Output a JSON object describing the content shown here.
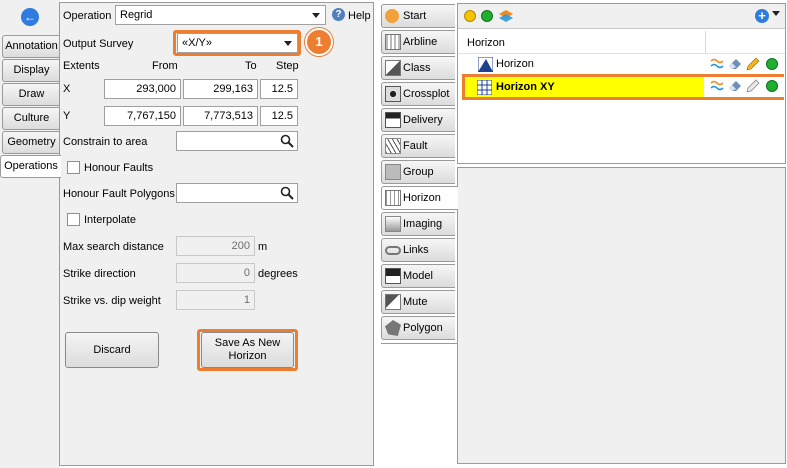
{
  "left_tabs": [
    "Annotation",
    "Display",
    "Draw",
    "Culture",
    "Geometry",
    "Operations"
  ],
  "operation": {
    "label": "Operation",
    "value": "Regrid",
    "help_label": "Help"
  },
  "output_survey": {
    "label": "Output Survey",
    "value": "«X/Y»",
    "callout": "1"
  },
  "extents": {
    "label": "Extents",
    "col_from": "From",
    "col_to": "To",
    "col_step": "Step",
    "x_label": "X",
    "x_from": "293,000",
    "x_to": "299,163",
    "x_step": "12.5",
    "y_label": "Y",
    "y_from": "7,767,150",
    "y_to": "7,773,513",
    "y_step": "12.5"
  },
  "constrain_label": "Constrain to area",
  "honour_faults_label": "Honour Faults",
  "honour_fault_polygons_label": "Honour Fault Polygons",
  "interpolate_label": "Interpolate",
  "max_search": {
    "label": "Max search distance",
    "value": "200",
    "unit": "m"
  },
  "strike": {
    "label": "Strike direction",
    "value": "0",
    "unit": "degrees"
  },
  "strike_dip": {
    "label": "Strike vs. dip weight",
    "value": "1"
  },
  "buttons": {
    "discard": "Discard",
    "save_line1": "Save As New",
    "save_line2": "Horizon"
  },
  "right_tabs": [
    "Start",
    "Arbline",
    "Class",
    "Crossplot",
    "Delivery",
    "Fault",
    "Group",
    "Horizon",
    "Imaging",
    "Links",
    "Model",
    "Mute",
    "Polygon"
  ],
  "layers": {
    "header": "Horizon",
    "items": [
      {
        "name": "Horizon"
      },
      {
        "name": "Horizon XY"
      }
    ]
  },
  "colors": {
    "accent": "#ed7d31",
    "highlight": "#ffff00"
  }
}
